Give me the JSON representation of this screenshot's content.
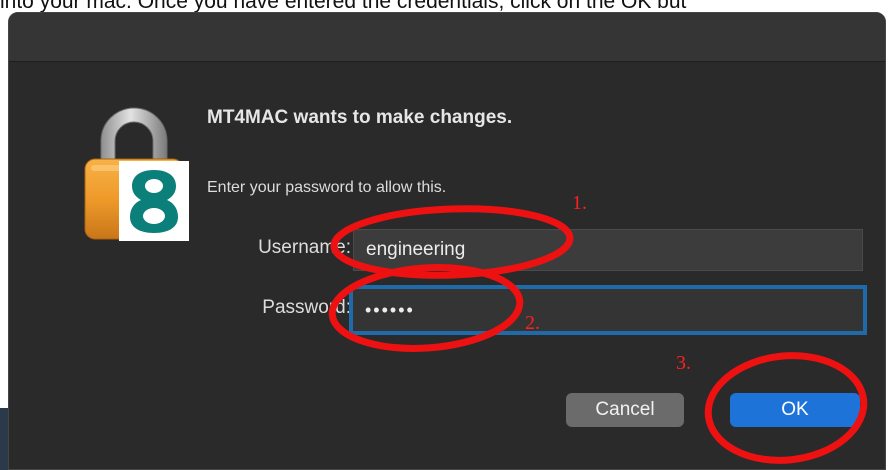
{
  "caption": {
    "text": "into your mac. Once you have entered the credentials, click on the OK but"
  },
  "dialog": {
    "heading": "MT4MAC wants to make changes.",
    "subtext": "Enter your password to allow this.",
    "username_label": "Username:",
    "username_value": "engineering",
    "password_label": "Password:",
    "password_value": "••••••",
    "cancel_label": "Cancel",
    "ok_label": "OK",
    "lock_icon": "padlock-icon",
    "app_icon": "app-logo-8"
  },
  "annotations": {
    "step1": "1.",
    "step2": "2.",
    "step3": "3.",
    "color": "#ff1f1f"
  },
  "colors": {
    "dialog_bg": "#2a2a2a",
    "field_bg": "#3c3c3c",
    "focus_ring": "#1f6aa8",
    "ok_button": "#1e73d8",
    "cancel_button": "#6b6b6b",
    "badge_teal": "#0b7f7a"
  }
}
